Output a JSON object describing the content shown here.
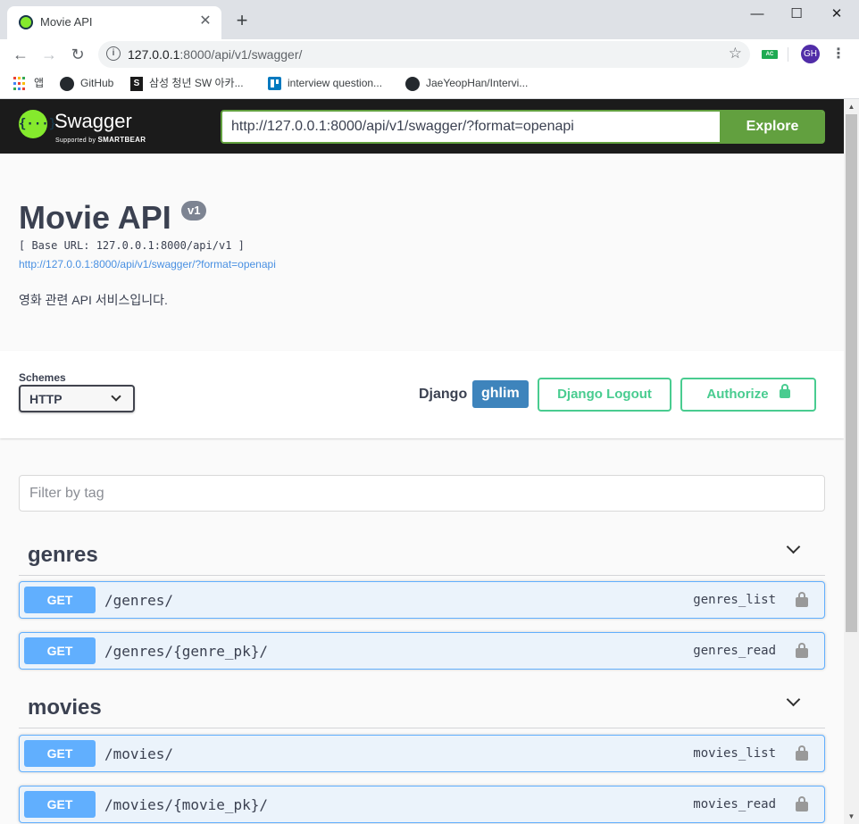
{
  "browser": {
    "tab_title": "Movie API",
    "tab_close": "✕",
    "new_tab": "+",
    "url_host": "127.0.0.1",
    "url_rest": ":8000/api/v1/swagger/",
    "avatar_initials": "GH",
    "extension_badge": "AC",
    "bookmarks": [
      {
        "label": "앱",
        "icon": "apps-grid-icon"
      },
      {
        "label": "GitHub",
        "icon": "github-icon"
      },
      {
        "label": "삼성 청년 SW 아카...",
        "icon": "samsung-s-icon"
      },
      {
        "label": "interview question...",
        "icon": "trello-icon"
      },
      {
        "label": "JaeYeopHan/Intervi...",
        "icon": "github-icon"
      }
    ]
  },
  "topbar": {
    "logo_text": "{···}",
    "brand": "Swagger",
    "sub_prefix": "Supported by",
    "sub_brand": "SMARTBEAR",
    "explore_url": "http://127.0.0.1:8000/api/v1/swagger/?format=openapi",
    "explore_button": "Explore",
    "accent_color": "#62a03f"
  },
  "info": {
    "title": "Movie API",
    "version": "v1",
    "base_url": "[ Base URL: 127.0.0.1:8000/api/v1 ]",
    "spec_link": "http://127.0.0.1:8000/api/v1/swagger/?format=openapi",
    "description": "영화 관련 API 서비스입니다."
  },
  "schemes": {
    "label": "Schemes",
    "selected": "HTTP",
    "django_label": "Django",
    "username": "ghlim",
    "logout_button": "Django Logout",
    "authorize_button": "Authorize"
  },
  "filter": {
    "placeholder": "Filter by tag"
  },
  "tags": [
    {
      "name": "genres",
      "operations": [
        {
          "method": "GET",
          "path": "/genres/",
          "operation_id": "genres_list"
        },
        {
          "method": "GET",
          "path": "/genres/{genre_pk}/",
          "operation_id": "genres_read"
        }
      ]
    },
    {
      "name": "movies",
      "operations": [
        {
          "method": "GET",
          "path": "/movies/",
          "operation_id": "movies_list"
        },
        {
          "method": "GET",
          "path": "/movies/{movie_pk}/",
          "operation_id": "movies_read"
        }
      ]
    }
  ],
  "colors": {
    "get_method": "#61affe",
    "authorize": "#49cc90",
    "user_badge": "#3e84bc"
  }
}
